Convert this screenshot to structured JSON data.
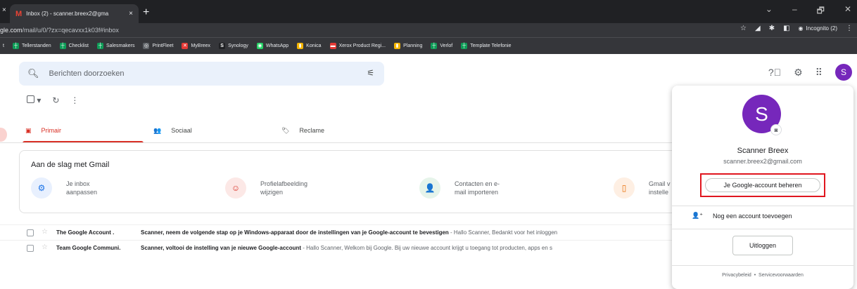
{
  "browser": {
    "tab_title": "Inbox (2) - scanner.breex2@gma",
    "tab_favicon": "M",
    "left_close": "×",
    "tab_close": "×",
    "new_tab": "+",
    "window_controls": [
      "⌄",
      "–",
      "🗗",
      "✕"
    ],
    "url_host": "gle.com",
    "url_path": "/mail/u/0/?zx=qecavxx1k03f#inbox",
    "incognito_label": "Incognito (2)"
  },
  "bookmarks": [
    {
      "label": "Tellerstanden",
      "icon_color": "#0f9d58",
      "icon": "┼"
    },
    {
      "label": "Checklist",
      "icon_color": "#0f9d58",
      "icon": "┼"
    },
    {
      "label": "Salesmakers",
      "icon_color": "#0f9d58",
      "icon": "┼"
    },
    {
      "label": "PrintFleet",
      "icon_color": "#5f6368",
      "icon": "◎"
    },
    {
      "label": "MyBreex",
      "icon_color": "#e53935",
      "icon": "✕"
    },
    {
      "label": "Synology",
      "icon_color": "#202124",
      "icon": "S"
    },
    {
      "label": "WhatsApp",
      "icon_color": "#25d366",
      "icon": "◉"
    },
    {
      "label": "Konica",
      "icon_color": "#f4b400",
      "icon": "▮"
    },
    {
      "label": "Xerox Product Regi...",
      "icon_color": "#e53935",
      "icon": "▬"
    },
    {
      "label": "Planning",
      "icon_color": "#f4b400",
      "icon": "▮"
    },
    {
      "label": "Verlof",
      "icon_color": "#0f9d58",
      "icon": "┼"
    },
    {
      "label": "Template Telefonie",
      "icon_color": "#0f9d58",
      "icon": "┼"
    }
  ],
  "gmail": {
    "search_placeholder": "Berichten doorzoeken",
    "avatar_letter": "S",
    "tabs": [
      {
        "label": "Primair",
        "icon": "▣"
      },
      {
        "label": "Sociaal",
        "icon": "👥"
      },
      {
        "label": "Reclame",
        "icon": "🏷"
      }
    ],
    "getstarted": {
      "title": "Aan de slag met Gmail",
      "items": [
        {
          "line1": "Je inbox",
          "line2": "aanpassen",
          "color": "#1a73e8",
          "bg": "#e8f0fe",
          "icon": "⚙"
        },
        {
          "line1": "Profielafbeelding",
          "line2": "wijzigen",
          "color": "#d93025",
          "bg": "#fce8e6",
          "icon": "☺"
        },
        {
          "line1": "Contacten en e-",
          "line2": "mail importeren",
          "color": "#1e8e3e",
          "bg": "#e6f4ea",
          "icon": "👤"
        },
        {
          "line1": "Gmail v",
          "line2": "instelle",
          "color": "#e8710a",
          "bg": "#feefe3",
          "icon": "▯"
        }
      ]
    },
    "emails": [
      {
        "sender": "The Google Account .",
        "subject": "Scanner, neem de volgende stap op je Windows-apparaat door de instellingen van je Google-account te bevestigen",
        "snippet": " - Hallo Scanner, Bedankt voor het inloggen"
      },
      {
        "sender": "Team Google Communi.",
        "subject": "Scanner, voltooi de instelling van je nieuwe Google-account",
        "snippet": " - Hallo Scanner, Welkom bij Google. Bij uw nieuwe account krijgt u toegang tot producten, apps en s"
      }
    ]
  },
  "account_panel": {
    "avatar_letter": "S",
    "name": "Scanner Breex",
    "email": "scanner.breex2@gmail.com",
    "manage_label": "Je Google-account beheren",
    "add_account_label": "Nog een account toevoegen",
    "logout_label": "Uitloggen",
    "privacy_label": "Privacybeleid",
    "dot": "•",
    "terms_label": "Servicevoorwaarden"
  }
}
